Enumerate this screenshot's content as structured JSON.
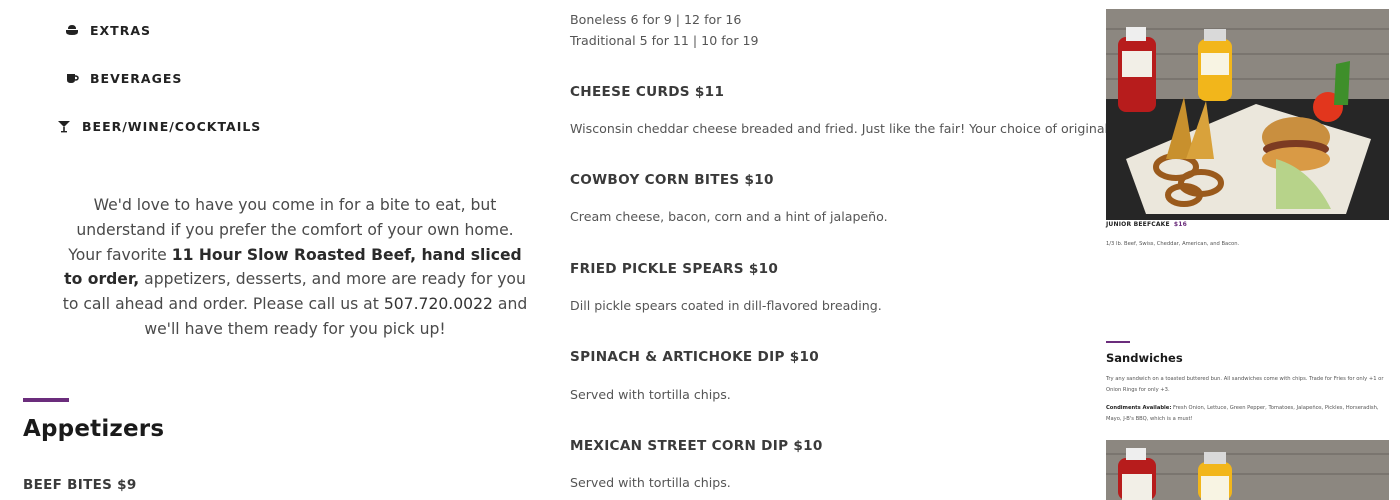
{
  "nav": {
    "items": [
      {
        "label": "EXTRAS",
        "icon": "bowl-icon"
      },
      {
        "label": "BEVERAGES",
        "icon": "cup-icon"
      },
      {
        "label": "BEER/WINE/COCKTAILS",
        "icon": "cocktail-icon"
      }
    ]
  },
  "intro": {
    "part1": "We'd love to have you come in for a bite to eat, but understand if you prefer the comfort of your own home. Your favorite ",
    "bold": "11 Hour Slow Roasted Beef, hand sliced to order,",
    "part2": " appetizers, desserts, and more are ready for you to call ahead and order. Please call us at ",
    "phone": "507.720.0022",
    "part3": " and we'll have them ready for you pick up!"
  },
  "section": {
    "title": "Appetizers",
    "first_item": "BEEF BITES $9"
  },
  "menu": {
    "top_lines": [
      "Boneless 6 for 9 | 12 for 16",
      "Traditional 5 for 11 | 10 for 19"
    ],
    "items": [
      {
        "name": "CHEESE CURDS $11",
        "desc": "Wisconsin cheddar cheese breaded and fried. Just like the fair! Your choice of original or spicy."
      },
      {
        "name": "COWBOY CORN BITES $10",
        "desc": "Cream cheese, bacon, corn and a hint of jalapeño."
      },
      {
        "name": "FRIED PICKLE SPEARS $10",
        "desc": "Dill pickle spears coated in dill-flavored breading."
      },
      {
        "name": "SPINACH & ARTICHOKE DIP $10",
        "desc": "Served with tortilla chips."
      },
      {
        "name": "MEXICAN STREET CORN DIP $10",
        "desc": "Served with tortilla chips."
      }
    ]
  },
  "right": {
    "photo_caption_title": "JUNIOR BEEFCAKE",
    "photo_caption_price": "$16",
    "photo_caption_desc": "1/3 lb. Beef, Swiss, Cheddar, American, and Bacon.",
    "sandwiches_title": "Sandwiches",
    "sandwiches_note": "Try any sandwich on a toasted buttered bun. All sandwiches come with chips. Trade for Fries for only +1 or Onion Rings for only +3.",
    "condiments_label": "Condiments Available:",
    "condiments_text": " Fresh Onion, Lettuce, Green Pepper, Tomatoes, Jalapeños, Pickles, Horseradish, Mayo, J-B's BBQ, which is a must!"
  },
  "colors": {
    "accent": "#6b2d7c",
    "text": "#3a3a3a"
  }
}
